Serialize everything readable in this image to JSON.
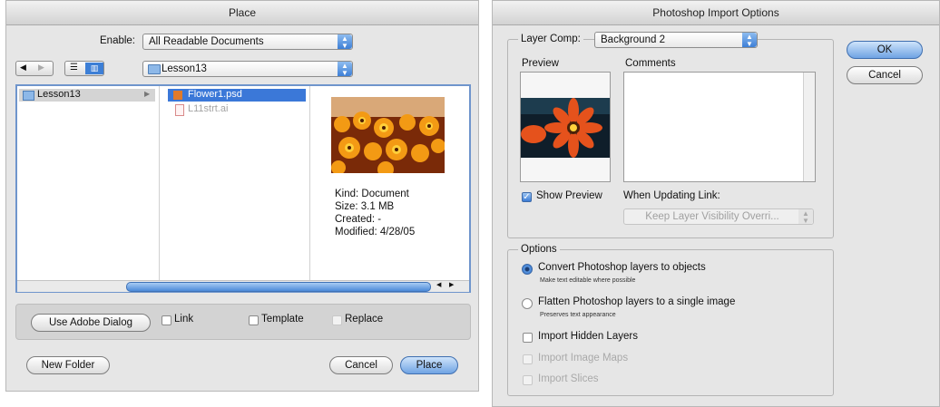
{
  "place": {
    "title": "Place",
    "enable_label": "Enable:",
    "enable_value": "All Readable Documents",
    "location": "Lesson13",
    "sidebar_folder": "Lesson13",
    "files": [
      "Flower1.psd",
      "L11strt.ai"
    ],
    "info": {
      "kind": "Kind: Document",
      "size": "Size: 3.1 MB",
      "created": "Created: -",
      "modified": "Modified: 4/28/05"
    },
    "use_adobe_dialog": "Use Adobe Dialog",
    "link": "Link",
    "template": "Template",
    "replace": "Replace",
    "new_folder": "New Folder",
    "cancel": "Cancel",
    "place_button": "Place"
  },
  "psimport": {
    "title": "Photoshop Import Options",
    "layer_comp_label": "Layer Comp:",
    "layer_comp_value": "Background 2",
    "preview_label": "Preview",
    "comments_label": "Comments",
    "show_preview": "Show Preview",
    "when_updating": "When Updating Link:",
    "keep_visibility": "Keep Layer Visibility Overri...",
    "options_label": "Options",
    "convert": "Convert Photoshop layers to objects",
    "convert_sub": "Make text editable where possible",
    "flatten": "Flatten Photoshop layers to a single image",
    "flatten_sub": "Preserves text appearance",
    "import_hidden": "Import Hidden Layers",
    "import_maps": "Import Image Maps",
    "import_slices": "Import Slices",
    "ok": "OK",
    "cancel": "Cancel"
  },
  "colors": {
    "accent": "#3d7fd6",
    "selection": "#3b78d8",
    "window_bg": "#e6e6e6"
  }
}
